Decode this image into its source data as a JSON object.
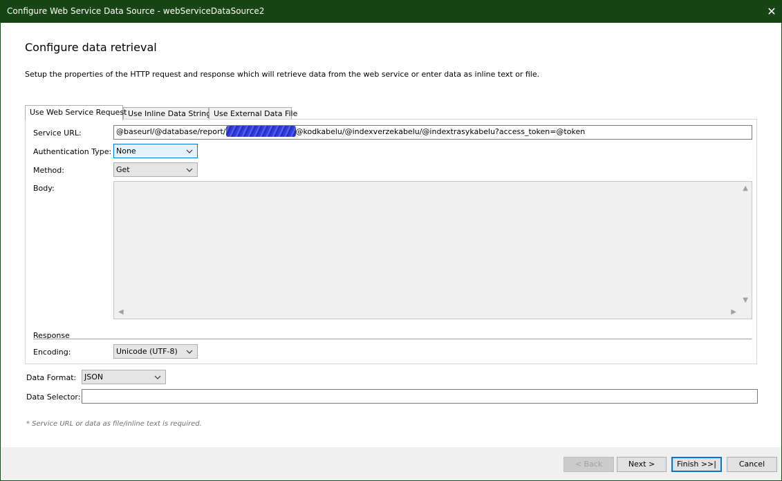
{
  "window": {
    "title": "Configure Web Service Data Source - webServiceDataSource2",
    "close_glyph": "✕"
  },
  "page": {
    "heading": "Configure data retrieval",
    "description": "Setup the properties of the HTTP request and response which will retrieve data from the web service or enter data as inline text or file."
  },
  "tabs": [
    {
      "label": "Use Web Service Request",
      "active": true
    },
    {
      "label": "Use Inline Data String",
      "active": false
    },
    {
      "label": "Use External Data File",
      "active": false
    }
  ],
  "request": {
    "service_url_label": "Service URL:",
    "service_url_prefix": "@baseurl/@database/report/",
    "service_url_suffix": "@kodkabelu/@indexverzekabelu/@indextrasykabelu?access_token=@token",
    "auth_type_label": "Authentication Type:",
    "auth_type_value": "None",
    "method_label": "Method:",
    "method_value": "Get",
    "body_label": "Body:",
    "body_value": ""
  },
  "response": {
    "section_label": "Response",
    "encoding_label": "Encoding:",
    "encoding_value": "Unicode (UTF-8)"
  },
  "data": {
    "format_label": "Data Format:",
    "format_value": "JSON",
    "selector_label": "Data Selector:",
    "selector_value": ""
  },
  "note": "* Service URL or data as file/inline text is required.",
  "buttons": {
    "back": "< Back",
    "next": "Next >",
    "finish": "Finish >>|",
    "cancel": "Cancel"
  },
  "icons": {
    "chevron": "chevron-down-icon",
    "scroll_up": "▲",
    "scroll_down": "▼",
    "scroll_left": "◀",
    "scroll_right": "▶"
  },
  "colors": {
    "titlebar": "#174516",
    "focus_accent": "#0078d7"
  }
}
